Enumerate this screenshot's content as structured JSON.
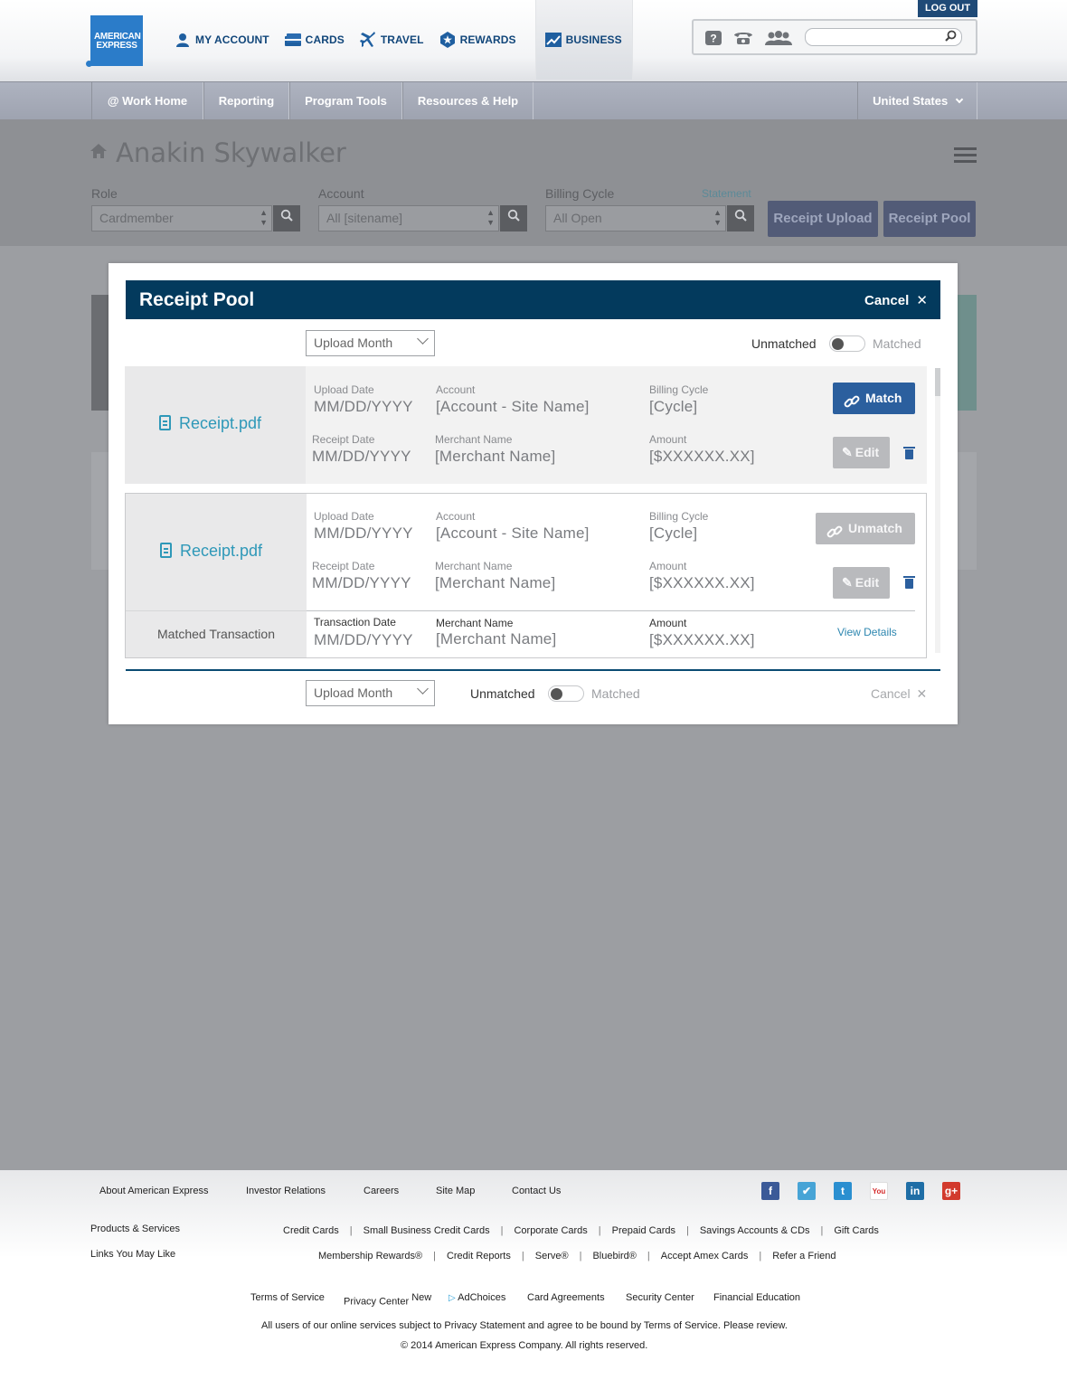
{
  "header": {
    "logo_text": "AMERICAN EXPRESS",
    "nav": [
      {
        "label": "MY ACCOUNT",
        "icon": "person-icon"
      },
      {
        "label": "CARDS",
        "icon": "card-icon"
      },
      {
        "label": "TRAVEL",
        "icon": "plane-icon"
      },
      {
        "label": "REWARDS",
        "icon": "star-badge-icon"
      },
      {
        "label": "BUSINESS",
        "icon": "chart-icon",
        "active": true
      }
    ],
    "logout": "LOG OUT",
    "utility_icons": [
      "help-icon",
      "phone-icon",
      "community-icon",
      "search-icon"
    ],
    "search_placeholder": ""
  },
  "subnav": {
    "items": [
      "@ Work Home",
      "Reporting",
      "Program Tools",
      "Resources & Help"
    ],
    "region": "United States"
  },
  "profile": {
    "name": "Anakin Skywalker",
    "filters": [
      {
        "label": "Role",
        "value": "Cardmember"
      },
      {
        "label": "Account",
        "value": "All [sitename]"
      },
      {
        "label": "Billing Cycle",
        "value": "All Open"
      }
    ],
    "statement_link": "Statement",
    "receipt_upload": "Receipt Upload",
    "receipt_pool": "Receipt Pool"
  },
  "modal": {
    "title": "Receipt Pool",
    "cancel": "Cancel",
    "upload_month": "Upload Month",
    "toggle_off_label": "Unmatched",
    "toggle_on_label": "Matched",
    "receipts": [
      {
        "file": "Receipt.pdf",
        "upload_date_label": "Upload Date",
        "upload_date": "MM/DD/YYYY",
        "account_label": "Account",
        "account": "[Account - Site Name]",
        "billing_label": "Billing Cycle",
        "billing": "[Cycle]",
        "receipt_date_label": "Receipt Date",
        "receipt_date": "MM/DD/YYYY",
        "merchant_label": "Merchant Name",
        "merchant": "[Merchant Name]",
        "amount_label": "Amount",
        "amount": "[$XXXXXX.XX]",
        "action": "Match",
        "edit": "Edit"
      },
      {
        "file": "Receipt.pdf",
        "upload_date_label": "Upload Date",
        "upload_date": "MM/DD/YYYY",
        "account_label": "Account",
        "account": "[Account - Site Name]",
        "billing_label": "Billing Cycle",
        "billing": "[Cycle]",
        "receipt_date_label": "Receipt Date",
        "receipt_date": "MM/DD/YYYY",
        "merchant_label": "Merchant Name",
        "merchant": "[Merchant Name]",
        "amount_label": "Amount",
        "amount": "[$XXXXXX.XX]",
        "action": "Unmatch",
        "edit": "Edit",
        "matched": {
          "title": "Matched Transaction",
          "date_label": "Transaction Date",
          "date": "MM/DD/YYYY",
          "merchant_label": "Merchant Name",
          "merchant": "[Merchant Name]",
          "amount_label": "Amount",
          "amount": "[$XXXXXX.XX]",
          "view": "View Details"
        }
      }
    ]
  },
  "footer": {
    "top_links": [
      "About American Express",
      "Investor Relations",
      "Careers",
      "Site Map",
      "Contact Us"
    ],
    "social": [
      "facebook-icon",
      "foursquare-icon",
      "twitter-icon",
      "youtube-icon",
      "linkedin-icon",
      "google-plus-icon"
    ],
    "products_label": "Products & Services",
    "products": [
      "Credit Cards",
      "Small Business Credit Cards",
      "Corporate Cards",
      "Prepaid Cards",
      "Savings Accounts & CDs",
      "Gift Cards"
    ],
    "links_label": "Links You May Like",
    "links": [
      "Membership Rewards®",
      "Credit Reports",
      "Serve®",
      "Bluebird®",
      "Accept Amex Cards",
      "Refer a Friend"
    ],
    "legal": [
      "Terms of Service",
      "Privacy Center",
      "AdChoices",
      "Card Agreements",
      "Security Center",
      "Financial Education"
    ],
    "new_badge": "New",
    "notice": "All users of our online services subject to Privacy Statement and agree to be bound by Terms of Service. Please review.",
    "copyright": "© 2014 American Express Company. All rights reserved."
  },
  "colors": {
    "brand_blue": "#2b7cc9",
    "modal_header": "#033a5d",
    "match_button": "#2b5f9e",
    "link": "#2e98b8"
  }
}
